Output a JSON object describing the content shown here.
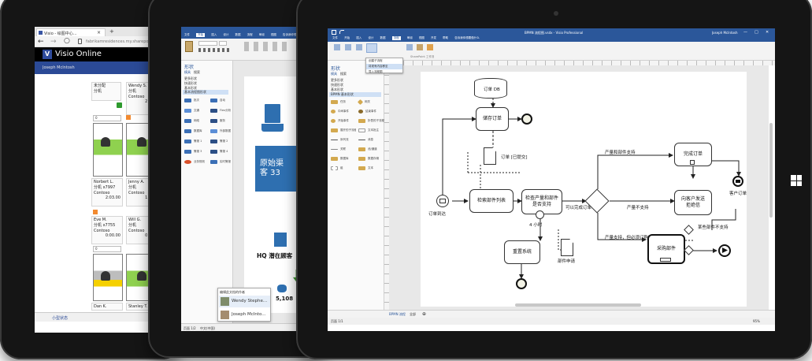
{
  "left_tablet": {
    "browser": {
      "tab_title": "Visio - 绘图中心...",
      "tab_close": "×",
      "new_tab": "+",
      "url": "fabrikamresidences.my.sharepo...",
      "back": "←",
      "forward": "→",
      "refresh": "○"
    },
    "app": {
      "logo_text": "V",
      "name": "Visio Online",
      "user": "Joseph McIntosh"
    },
    "cards": [
      {
        "name": "未分配",
        "line2": "分机"
      },
      {
        "name": "Wendy S.",
        "line2": "分机",
        "line3": "Contoso",
        "line4": "2:3..."
      },
      {
        "name": "Norbert L.",
        "line2": "分机    x7997",
        "line3": "Contoso",
        "line4": "2:03.00"
      },
      {
        "name": "Jenny A.",
        "line2": "分机",
        "line3": "Contoso",
        "line4": "1:3..."
      },
      {
        "name": "Eve M.",
        "line2": "分机    x7755",
        "line3": "Contoso",
        "line4": "0:00.00"
      },
      {
        "name": "Will G.",
        "line2": "分机",
        "line3": "Contoso",
        "line4": "0:0..."
      },
      {
        "name": "Dan K."
      },
      {
        "name": "Stanley T."
      }
    ],
    "desk_labels": [
      "0",
      "0"
    ],
    "bottom_tab": "小型状态"
  },
  "middle_tablet": {
    "ribbon_tabs": [
      "文件",
      "开始",
      "插入",
      "设计",
      "数据",
      "流程",
      "审阅",
      "视图"
    ],
    "tell_me": "告诉我你想要做什么",
    "panel": {
      "title": "形状",
      "tabs": [
        "模具",
        "搜索"
      ],
      "sections": [
        "更多形状",
        "快速形状",
        "基本形状",
        "基本流程图形状"
      ]
    },
    "shape_rows": [
      [
        "批次",
        "自动"
      ],
      [
        "交通",
        "Flex分析"
      ],
      [
        "网络",
        "服务"
      ],
      [
        "数据库",
        "外部数据"
      ],
      [
        "警报 1",
        "警报 2"
      ],
      [
        "警报 3",
        "警报 4"
      ],
      [
        "业务规则",
        "实时警报"
      ]
    ],
    "canvas": {
      "big_text": "原始渠\n客 33",
      "hq_label": "HQ 潜在顾客",
      "number": "5,108"
    },
    "presence": {
      "header": "编辑此文档的作者",
      "people": [
        "Wendy Stephe...",
        "Joseph McInto..."
      ]
    },
    "status": [
      "页面 1/2",
      "中文(中国)",
      "100%"
    ]
  },
  "right_tablet": {
    "title_bar": "BPMN 流程图.vsdx - Visio Professional",
    "user": "Joseph McIntosh",
    "window_buttons": [
      "—",
      "□",
      "✕"
    ],
    "ribbon_tabs": [
      "文件",
      "开始",
      "插入",
      "设计",
      "数据",
      "流程",
      "审阅",
      "视图",
      "开发",
      "帮助"
    ],
    "tell_me": "告诉我你想要做什么",
    "dropdown": [
      "创建子流程",
      "将现有内容移至",
      "导入流程图"
    ],
    "ribbon_group_label": "SharePoint 工作流",
    "panel": {
      "title": "形状",
      "tabs": [
        "模具",
        "搜索"
      ],
      "sections": [
        "更多形状",
        "快速形状",
        "基本形状",
        "BPMN 基本形状"
      ]
    },
    "shape_rows": [
      [
        "任务",
        "网关"
      ],
      [
        "中间事件",
        "结束事件"
      ],
      [
        "开始事件",
        "折叠的子流程"
      ],
      [
        "展开的子流程",
        "文本批注"
      ],
      [
        "序列流",
        "消息"
      ],
      [
        "关联",
        "池/通道"
      ],
      [
        "数据库",
        "数据存储"
      ],
      [
        "组",
        "文本"
      ]
    ],
    "diagram": {
      "db": "订单 DB",
      "store_order": "储存订单",
      "doc_label": "订单 [已提交]",
      "check_part": "检索部件列表",
      "check_stock": "检查产量和部件\n是否支持",
      "can_finish": "可以完成订单",
      "order_received": "订单到达",
      "timer": "4 小时",
      "reorder": "重置系统",
      "request_doc": "部件申请",
      "produce_part": "产量和部件支持",
      "not_support": "产量不支持",
      "part_delay": "产量支持，但必须订购部件",
      "complete": "完成订单",
      "notify": "向客户发送\n拒绝信",
      "purchase": "采购部件",
      "backorder": "某些部件不支持",
      "customer": "客户订单"
    },
    "page_tab": "BPMN 流程",
    "page_tab_all": "全部",
    "status_left": "页面 1/1",
    "status_right": "95%"
  },
  "windows_logo": "windows-logo"
}
